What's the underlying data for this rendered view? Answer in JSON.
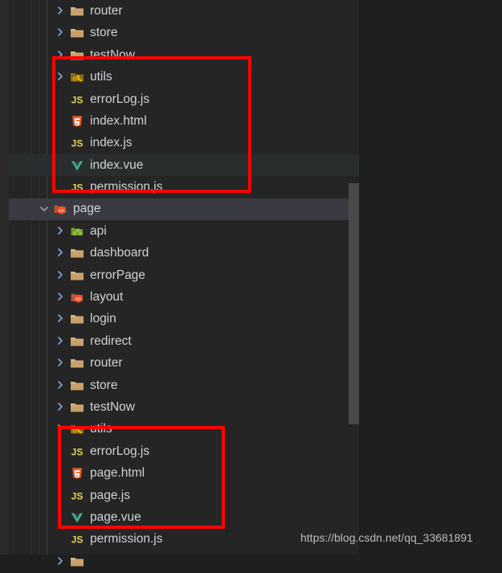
{
  "app": {
    "theme_bg": "#252526",
    "editor_bg": "#1e1f1f",
    "text_color": "#cfd3d6",
    "annotation_color": "#fc0404",
    "selection_color": "#3a3a42"
  },
  "watermark": {
    "text": "https://blog.csdn.net/qq_33681891"
  },
  "explorer": {
    "scrollbar": {
      "visible": true
    },
    "rows": [
      {
        "label": "router",
        "icon": "folder-icon",
        "indent": "d1",
        "twisty": "chevron-right-icon",
        "state": ""
      },
      {
        "label": "store",
        "icon": "folder-icon",
        "indent": "d1",
        "twisty": "chevron-right-icon",
        "state": ""
      },
      {
        "label": "testNow",
        "icon": "folder-icon",
        "indent": "d1",
        "twisty": "chevron-right-icon",
        "state": ""
      },
      {
        "label": "utils",
        "icon": "folder-tools-icon",
        "indent": "d1",
        "twisty": "chevron-right-icon",
        "state": ""
      },
      {
        "label": "errorLog.js",
        "icon": "js-file-icon",
        "indent": "dfile",
        "twisty": "",
        "state": ""
      },
      {
        "label": "index.html",
        "icon": "html5-file-icon",
        "indent": "dfile",
        "twisty": "",
        "state": ""
      },
      {
        "label": "index.js",
        "icon": "js-file-icon",
        "indent": "dfile",
        "twisty": "",
        "state": ""
      },
      {
        "label": "index.vue",
        "icon": "vue-file-icon",
        "indent": "dfile",
        "twisty": "",
        "state": "hover"
      },
      {
        "label": "permission.js",
        "icon": "js-file-icon",
        "indent": "dfile",
        "twisty": "",
        "state": ""
      },
      {
        "label": "page",
        "icon": "folder-vue-icon",
        "indent": "droot",
        "twisty": "chevron-down-icon",
        "state": "selected"
      },
      {
        "label": "api",
        "icon": "folder-api-icon",
        "indent": "d2",
        "twisty": "chevron-right-icon",
        "state": ""
      },
      {
        "label": "dashboard",
        "icon": "folder-icon",
        "indent": "d2",
        "twisty": "chevron-right-icon",
        "state": ""
      },
      {
        "label": "errorPage",
        "icon": "folder-icon",
        "indent": "d2",
        "twisty": "chevron-right-icon",
        "state": ""
      },
      {
        "label": "layout",
        "icon": "folder-vue-icon",
        "indent": "d2",
        "twisty": "chevron-right-icon",
        "state": ""
      },
      {
        "label": "login",
        "icon": "folder-icon",
        "indent": "d2",
        "twisty": "chevron-right-icon",
        "state": ""
      },
      {
        "label": "redirect",
        "icon": "folder-icon",
        "indent": "d2",
        "twisty": "chevron-right-icon",
        "state": ""
      },
      {
        "label": "router",
        "icon": "folder-icon",
        "indent": "d2",
        "twisty": "chevron-right-icon",
        "state": ""
      },
      {
        "label": "store",
        "icon": "folder-icon",
        "indent": "d2",
        "twisty": "chevron-right-icon",
        "state": ""
      },
      {
        "label": "testNow",
        "icon": "folder-icon",
        "indent": "d2",
        "twisty": "chevron-right-icon",
        "state": ""
      },
      {
        "label": "utils",
        "icon": "folder-tools-icon",
        "indent": "d2",
        "twisty": "chevron-right-icon",
        "state": ""
      },
      {
        "label": "errorLog.js",
        "icon": "js-file-icon",
        "indent": "dfile",
        "twisty": "",
        "state": ""
      },
      {
        "label": "page.html",
        "icon": "html5-file-icon",
        "indent": "dfile",
        "twisty": "",
        "state": ""
      },
      {
        "label": "page.js",
        "icon": "js-file-icon",
        "indent": "dfile",
        "twisty": "",
        "state": ""
      },
      {
        "label": "page.vue",
        "icon": "vue-file-icon",
        "indent": "dfile",
        "twisty": "",
        "state": ""
      },
      {
        "label": "permission.js",
        "icon": "js-file-icon",
        "indent": "dfile",
        "twisty": "",
        "state": ""
      },
      {
        "label": "",
        "icon": "folder-icon",
        "indent": "d2",
        "twisty": "chevron-right-icon",
        "state": ""
      }
    ]
  },
  "annotations": [
    {
      "name": "red-highlight-box-utils-files",
      "label": ""
    },
    {
      "name": "red-highlight-box-page-files",
      "label": ""
    }
  ]
}
